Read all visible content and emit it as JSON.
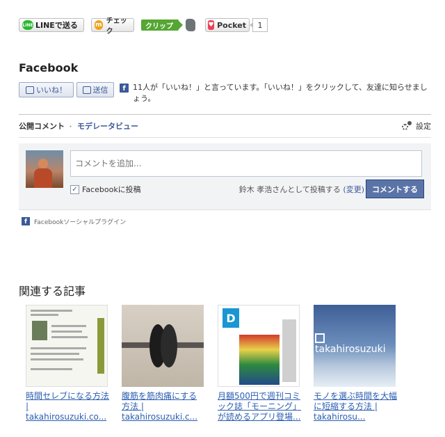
{
  "share_bar": {
    "line_logo": "LINE",
    "line_label": "LINEで送る",
    "check_logo": "m",
    "check_label": "チェック",
    "clip_label": "クリップ",
    "pocket_logo": "♥",
    "pocket_label": "Pocket",
    "pocket_count": "1"
  },
  "facebook": {
    "title": "Facebook",
    "like_label": "いいね！",
    "send_label": "送信",
    "logo": "f",
    "like_text": "11人が「いいね！」と言っています。「いいね！」をクリックして、友達に知らせましょう。"
  },
  "comments": {
    "tab_public": "公開コメント",
    "separator": "・",
    "tab_moderator": "モデレータビュー",
    "settings_label": "設定",
    "input_placeholder": "コメントを追加...",
    "checkbox_mark": "✓",
    "post_to_facebook": "Facebookに投稿",
    "posting_as": "鈴木 孝浩さんとして投稿する",
    "change_link": "(変更)",
    "submit_label": "コメントする",
    "plugin_logo": "f",
    "plugin_label": "Facebookソーシャルプラグイン"
  },
  "related": {
    "title": "関連する記事",
    "items": [
      {
        "title": "時間セレブになる方法 | takahirosuzuki.co..."
      },
      {
        "title": "腹筋を筋肉痛にする方法 | takahirosuzuki.c..."
      },
      {
        "title": "月額500円で週刊コミック誌「モーニング」が読めるアプリ登場..."
      },
      {
        "title": "モノを選ぶ時間を大幅に短縮する方法 | takahirosu..."
      }
    ],
    "thumb3_logo": "D",
    "thumb4_brand": "takahirosuzuki"
  },
  "colors": {
    "facebook_blue": "#3b5998",
    "link_blue": "#2a5db0",
    "line_green": "#2bb930",
    "clip_green": "#55a632",
    "pocket_red": "#ee4056"
  }
}
